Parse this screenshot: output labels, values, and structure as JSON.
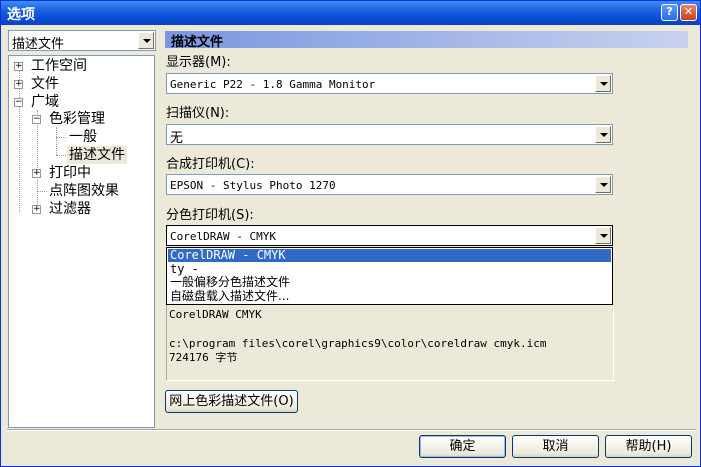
{
  "window": {
    "title": "选项"
  },
  "titlebar": {
    "help_glyph": "?",
    "close_glyph": "✕"
  },
  "category_select": {
    "value": "描述文件"
  },
  "tree": {
    "items": [
      {
        "label": "工作空间",
        "expander": "+"
      },
      {
        "label": "文件",
        "expander": "+"
      },
      {
        "label": "广域",
        "expander": "−"
      },
      {
        "label": "色彩管理",
        "expander": "−"
      },
      {
        "label": "一般",
        "expander": ""
      },
      {
        "label": "描述文件",
        "expander": ""
      },
      {
        "label": "打印中",
        "expander": "+"
      },
      {
        "label": "点阵图效果",
        "expander": ""
      },
      {
        "label": "过滤器",
        "expander": "+"
      }
    ]
  },
  "panel": {
    "title": "描述文件",
    "monitor": {
      "label": "显示器(M):",
      "value": "Generic P22 -  1.8 Gamma Monitor"
    },
    "scanner": {
      "label": "扫描仪(N):",
      "value": "无"
    },
    "composite_printer": {
      "label": "合成打印机(C):",
      "value": "EPSON -  Stylus Photo 1270"
    },
    "separation_printer": {
      "label": "分色打印机(S):",
      "value": "CorelDRAW -  CMYK"
    },
    "dropdown_options": [
      "CorelDRAW -  CMYK",
      "ty -",
      "一般偏移分色描述文件",
      "自磁盘载入描述文件..."
    ],
    "info": {
      "name": "CorelDRAW CMYK",
      "path": "c:\\program files\\corel\\graphics9\\color\\coreldraw cmyk.icm",
      "size": "724176 字节"
    },
    "web_button": "网上色彩描述文件(O)"
  },
  "footer": {
    "ok": "确定",
    "cancel": "取消",
    "help": "帮助(H)"
  },
  "colors": {
    "selection": "#316ac5",
    "titlebar": "#0a4ed6"
  }
}
